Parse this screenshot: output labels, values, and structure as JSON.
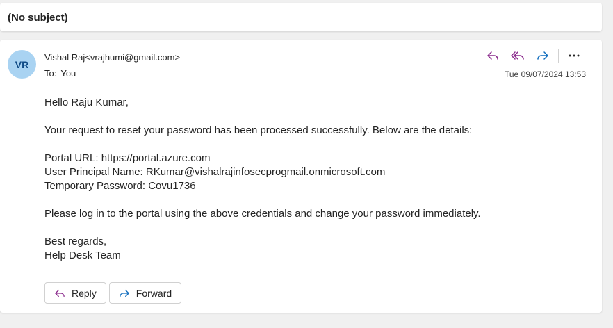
{
  "subject": "(No subject)",
  "sender": {
    "initials": "VR",
    "from_text": "Vishal Raj<vrajhumi@gmail.com>",
    "to_label": "To:",
    "to_value": "You",
    "date": "Tue 09/07/2024 13:53"
  },
  "actions": {
    "reply_icon": "reply-icon",
    "reply_all_icon": "reply-all-icon",
    "forward_icon": "forward-icon",
    "more_icon": "more-icon",
    "reply_color": "#8a2a8c",
    "forward_color": "#0f6cbd"
  },
  "body": {
    "greeting": "Hello Raju Kumar,",
    "intro": "Your request to reset your password has been processed successfully. Below are the details:",
    "portal_url": "Portal URL: https://portal.azure.com",
    "upn": "User Principal Name: RKumar@vishalrajinfosecprogmail.onmicrosoft.com",
    "temp_password": "Temporary Password: Covu1736",
    "instruction": "Please log in to the portal using the above credentials and change your password immediately.",
    "closing": "Best regards,",
    "signature": "Help Desk Team"
  },
  "footer_buttons": {
    "reply_label": "Reply",
    "forward_label": "Forward"
  }
}
